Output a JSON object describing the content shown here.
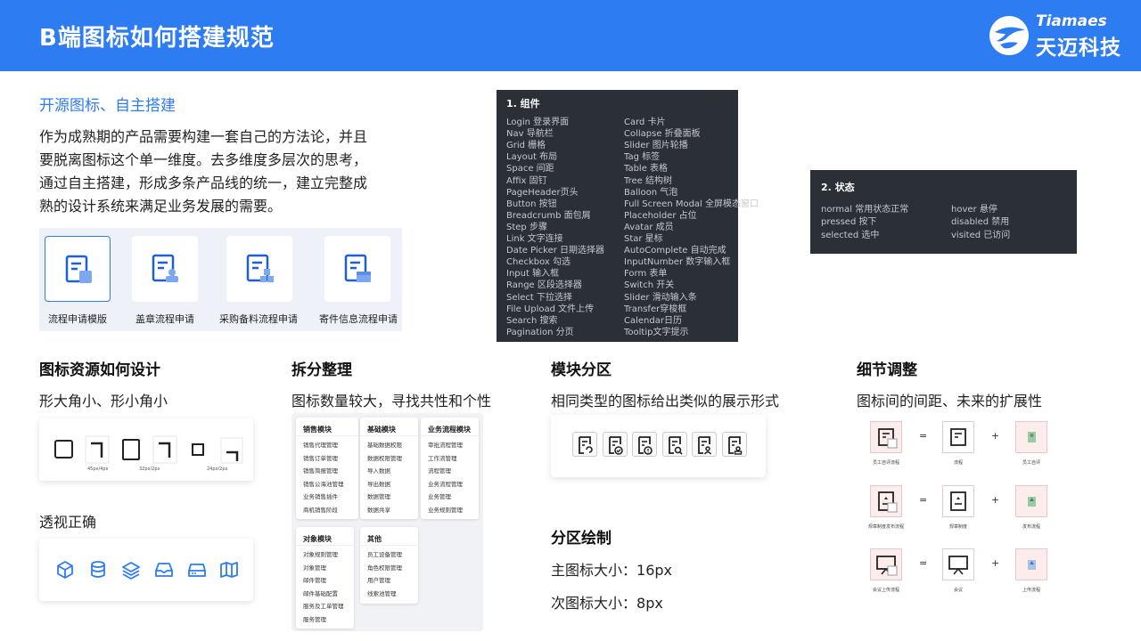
{
  "header": {
    "title": "B端图标如何搭建规范",
    "logo_en": "Tiamaes",
    "logo_cn": "天迈科技"
  },
  "intro": {
    "subtitle": "开源图标、自主搭建",
    "paragraph_lines": [
      "作为成熟期的产品需要构建一套自己的方法论，并且",
      "要脱离图标这个单一维度。去多维度多层次的思考，",
      "通过自主搭建，形成多条产品线的统一，建立完整成",
      "熟的设计系统来满足业务发展的需要。"
    ],
    "icon_cards": [
      {
        "label": "流程申请模版",
        "icon": "document-square-icon",
        "selected": true
      },
      {
        "label": "盖章流程申请",
        "icon": "document-stamp-icon",
        "selected": false
      },
      {
        "label": "采购备料流程申请",
        "icon": "document-cubes-icon",
        "selected": false
      },
      {
        "label": "寄件信息流程申请",
        "icon": "document-box-icon",
        "selected": false
      }
    ]
  },
  "components_panel": {
    "heading": "1. 组件",
    "left": [
      "Login 登录界面",
      "Nav 导航栏",
      "Grid 栅格",
      "Layout 布局",
      "Space 间距",
      "Affix 固钉",
      "PageHeader页头",
      "Button 按钮",
      "Breadcrumb 面包屑",
      "Step 步骤",
      "Link 文字连接",
      "Date Picker 日期选择器",
      "Checkbox 勾选",
      "Input 输入框",
      "Range 区段选择器",
      "Select 下拉选择",
      "File Upload 文件上传",
      "Search 搜索",
      "Pagination 分页"
    ],
    "right": [
      "Card 卡片",
      "Collapse 折叠面板",
      "Slider 图片轮播",
      "Tag 标签",
      "Table 表格",
      "Tree 结构树",
      "Balloon 气泡",
      "Full Screen Modal 全屏模态窗口",
      "Placeholder 占位",
      "Avatar 成员",
      "Star 星标",
      "AutoComplete 自动完成",
      "InputNumber 数字输入框",
      "Form 表单",
      "Switch 开关",
      "Slider 滑动输入条",
      "Transfer穿梭框",
      "Calendar日历",
      "Tooltip文字提示"
    ]
  },
  "states_panel": {
    "heading": "2. 状态",
    "left": [
      "normal 常用状态正常",
      "pressed 按下",
      "selected 选中"
    ],
    "right": [
      "hover 悬停",
      "disabled 禁用",
      "visited 已访问"
    ]
  },
  "col1": {
    "title": "图标资源如何设计",
    "subtitle": "形大角小、形小角小",
    "corner_labels": [
      "45px/4px",
      "32px/2px",
      "24px/2px"
    ],
    "perspective_title": "透视正确",
    "perspective_icons": [
      "cube-icon",
      "database-icon",
      "layers-icon",
      "inbox-icon",
      "drive-icon",
      "map-icon"
    ]
  },
  "col2": {
    "title": "拆分整理",
    "subtitle": "图标数量较大，寻找共性和个性",
    "modules": [
      {
        "name": "销售模块",
        "items": [
          "销售代理管理",
          "销售订单管理",
          "销售简报管理",
          "销售公海池管理",
          "业务销售插件",
          "商机销售阶段"
        ]
      },
      {
        "name": "基础模块",
        "items": [
          "基础数据权限",
          "数据权限管理",
          "导入数据",
          "导出数据",
          "数据管理",
          "数据共享"
        ]
      },
      {
        "name": "业务流程模块",
        "items": [
          "审批流程管理",
          "工作流管理",
          "流程管理",
          "业务流程管理",
          "业务管理",
          "业务规则管理"
        ]
      },
      {
        "name": "对象模块",
        "items": [
          "对象规则管理",
          "对象管理",
          "邮件管理",
          "邮件基础配置",
          "服务及工单管理",
          "服务管理"
        ]
      },
      {
        "name": "其他",
        "items": [
          "员工设备管理",
          "角色权限管理",
          "用户管理",
          "线索池管理"
        ]
      }
    ]
  },
  "col3": {
    "title": "模块分区",
    "subtitle": "相同类型的图标给出类似的展示形式",
    "doc_icons": [
      "doc-refresh-icon",
      "doc-check-icon",
      "doc-alert-icon",
      "doc-search-icon",
      "doc-user-icon",
      "doc-stamp-icon"
    ],
    "draw_title": "分区绘制",
    "main_size_label": "主图标大小：",
    "main_size": "16px",
    "sub_size_label": "次图标大小：",
    "sub_size": "8px"
  },
  "col4": {
    "title": "细节调整",
    "subtitle": "图标间的间距、未来的扩展性",
    "rows": [
      {
        "a": "员工自评流程",
        "b": "流程",
        "c": "员工自评"
      },
      {
        "a": "规章制度发布流程",
        "b": "规章制度",
        "c": "发布流程"
      },
      {
        "a": "会议上传流程",
        "b": "会议",
        "c": "上传流程"
      }
    ],
    "equals": "=",
    "plus": "+"
  },
  "colors": {
    "brand": "#2d7cf1",
    "dark_panel": "#2b2f36"
  }
}
